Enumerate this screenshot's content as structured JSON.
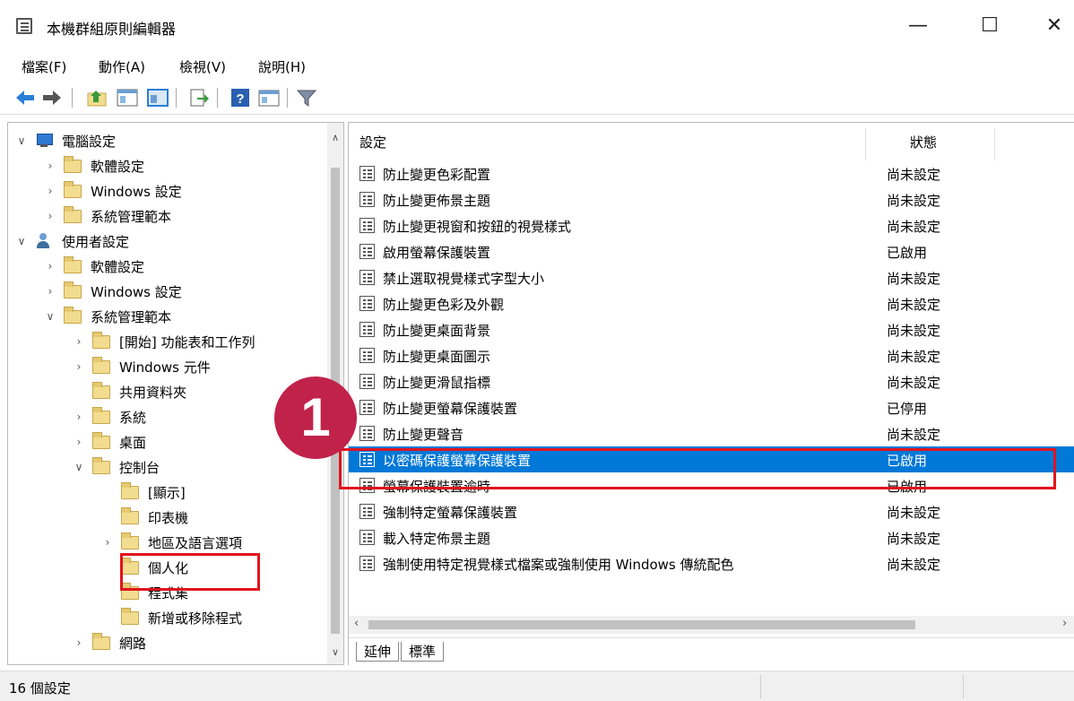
{
  "window": {
    "title": "本機群組原則編輯器",
    "minimize": "—",
    "maximize": "☐",
    "close": "✕"
  },
  "menu": [
    "檔案(F)",
    "動作(A)",
    "檢視(V)",
    "說明(H)"
  ],
  "toolbar_icons": [
    "back-icon",
    "forward-icon",
    "up-folder-icon",
    "show-hide-tree-icon",
    "export-list-icon",
    "help-icon",
    "properties-icon",
    "filter-icon"
  ],
  "tree": [
    {
      "label": "電腦設定",
      "level": 0,
      "expanded": true,
      "icon": "computer-icon"
    },
    {
      "label": "軟體設定",
      "level": 1,
      "expanded": false,
      "icon": "folder-icon"
    },
    {
      "label": "Windows 設定",
      "level": 1,
      "expanded": false,
      "icon": "folder-icon"
    },
    {
      "label": "系統管理範本",
      "level": 1,
      "expanded": false,
      "icon": "folder-icon"
    },
    {
      "label": "使用者設定",
      "level": 0,
      "expanded": true,
      "icon": "user-icon"
    },
    {
      "label": "軟體設定",
      "level": 1,
      "expanded": false,
      "icon": "folder-icon"
    },
    {
      "label": "Windows 設定",
      "level": 1,
      "expanded": false,
      "icon": "folder-icon"
    },
    {
      "label": "系統管理範本",
      "level": 1,
      "expanded": true,
      "icon": "folder-icon"
    },
    {
      "label": "[開始] 功能表和工作列",
      "level": 2,
      "expanded": false,
      "icon": "folder-icon"
    },
    {
      "label": "Windows 元件",
      "level": 2,
      "expanded": false,
      "icon": "folder-icon"
    },
    {
      "label": "共用資料夾",
      "level": 2,
      "expanded": null,
      "icon": "folder-icon"
    },
    {
      "label": "系統",
      "level": 2,
      "expanded": false,
      "icon": "folder-icon"
    },
    {
      "label": "桌面",
      "level": 2,
      "expanded": false,
      "icon": "folder-icon"
    },
    {
      "label": "控制台",
      "level": 2,
      "expanded": true,
      "icon": "folder-icon"
    },
    {
      "label": "[顯示]",
      "level": 3,
      "expanded": null,
      "icon": "folder-icon"
    },
    {
      "label": "印表機",
      "level": 3,
      "expanded": null,
      "icon": "folder-icon"
    },
    {
      "label": "地區及語言選項",
      "level": 3,
      "expanded": false,
      "icon": "folder-icon"
    },
    {
      "label": "個人化",
      "level": 3,
      "expanded": null,
      "icon": "folder-icon",
      "selected": true
    },
    {
      "label": "程式集",
      "level": 3,
      "expanded": null,
      "icon": "folder-icon"
    },
    {
      "label": "新增或移除程式",
      "level": 3,
      "expanded": null,
      "icon": "folder-icon"
    },
    {
      "label": "網路",
      "level": 2,
      "expanded": false,
      "icon": "folder-icon"
    }
  ],
  "list": {
    "col_setting": "設定",
    "col_state": "狀態",
    "rows": [
      {
        "name": "防止變更色彩配置",
        "state": "尚未設定"
      },
      {
        "name": "防止變更佈景主題",
        "state": "尚未設定"
      },
      {
        "name": "防止變更視窗和按鈕的視覺樣式",
        "state": "尚未設定"
      },
      {
        "name": "啟用螢幕保護裝置",
        "state": "已啟用"
      },
      {
        "name": "禁止選取視覺樣式字型大小",
        "state": "尚未設定"
      },
      {
        "name": "防止變更色彩及外觀",
        "state": "尚未設定"
      },
      {
        "name": "防止變更桌面背景",
        "state": "尚未設定"
      },
      {
        "name": "防止變更桌面圖示",
        "state": "尚未設定"
      },
      {
        "name": "防止變更滑鼠指標",
        "state": "尚未設定"
      },
      {
        "name": "防止變更螢幕保護裝置",
        "state": "已停用"
      },
      {
        "name": "防止變更聲音",
        "state": "尚未設定"
      },
      {
        "name": "以密碼保護螢幕保護裝置",
        "state": "已啟用",
        "selected": true
      },
      {
        "name": "螢幕保護裝置逾時",
        "state": "已啟用"
      },
      {
        "name": "強制特定螢幕保護裝置",
        "state": "尚未設定"
      },
      {
        "name": "載入特定佈景主題",
        "state": "尚未設定"
      },
      {
        "name": "強制使用特定視覺樣式檔案或強制使用 Windows 傳統配色",
        "state": "尚未設定"
      }
    ]
  },
  "tabs": [
    "延伸",
    "標準"
  ],
  "status": "16 個設定",
  "annotation": {
    "badge": "1",
    "color": "#e0141e",
    "badge_color": "#c1224a"
  }
}
